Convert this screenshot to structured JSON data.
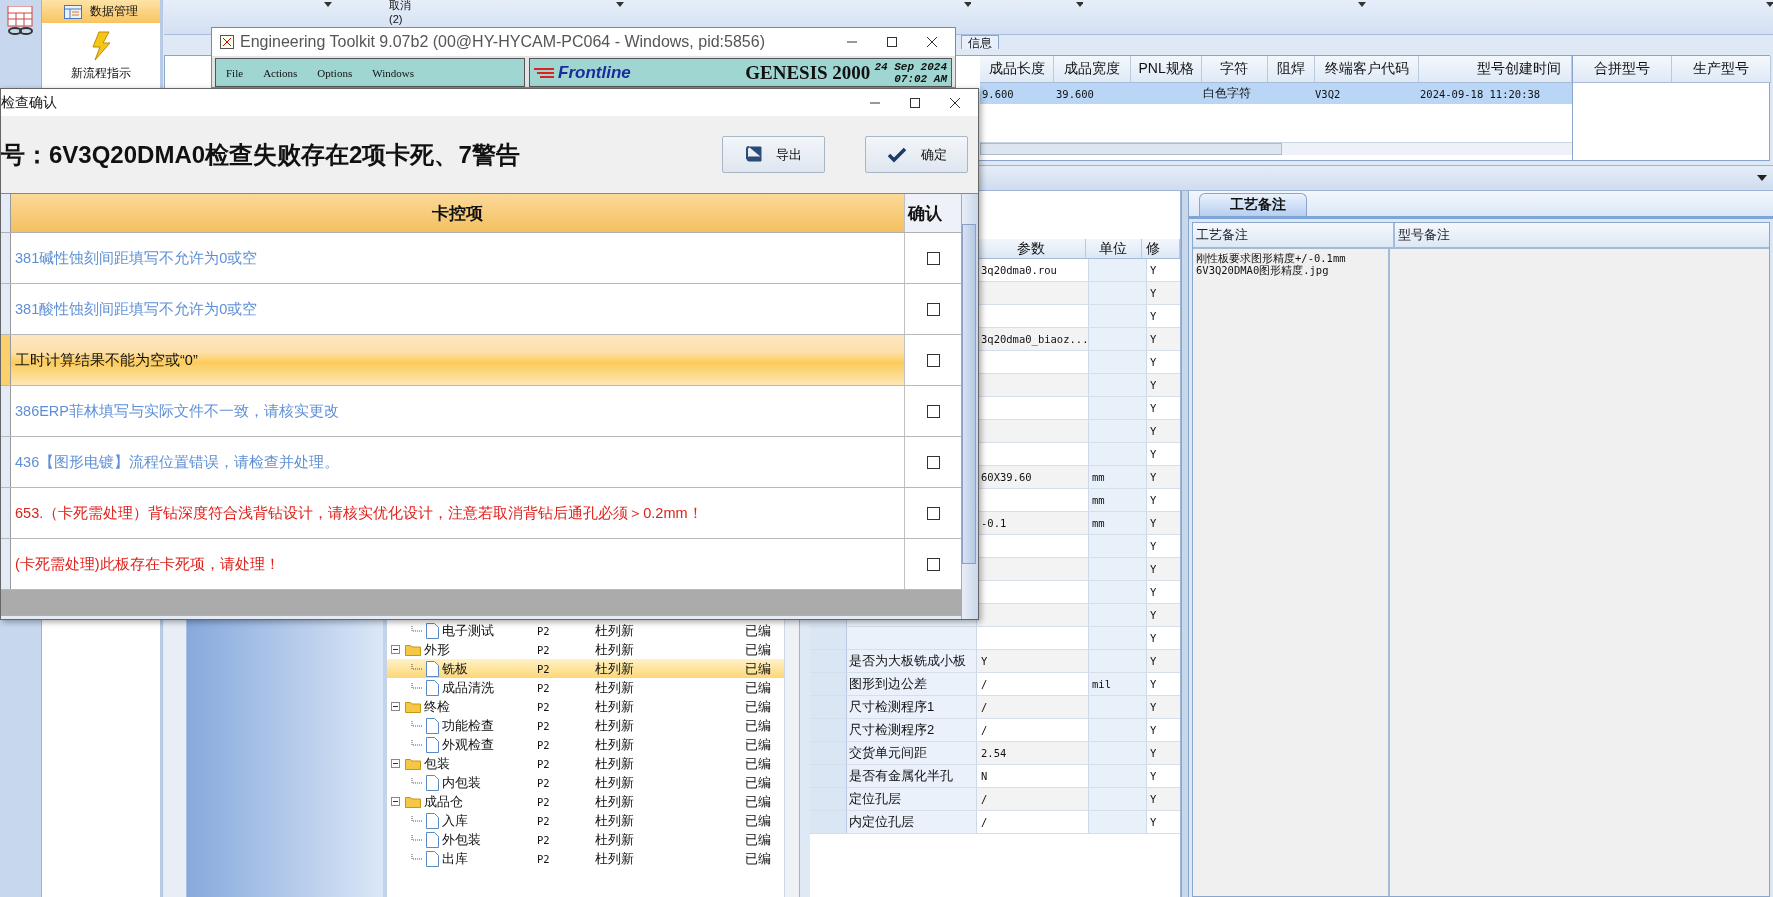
{
  "ribbon": {
    "label": "取消(2)"
  },
  "sidebar": {
    "items": [
      {
        "label": "数据管理",
        "kind": "table",
        "selected": true
      },
      {
        "label": "新流程指示",
        "kind": "flash",
        "selected": false
      }
    ]
  },
  "info_panel": {
    "tab": "信息",
    "columns": [
      "成品长度",
      "成品宽度",
      "PNL规格",
      "字符",
      "阻焊",
      "终端客户代码",
      "型号创建时间"
    ],
    "rows": [
      {
        "cells": [
          "9.600",
          "39.600",
          "",
          "白色字符",
          "",
          "V3Q2",
          "2024-09-18 11:20:38"
        ],
        "selected": true
      }
    ],
    "side_columns": [
      "合拼型号",
      "生产型号"
    ]
  },
  "tree": {
    "nodes": [
      {
        "children": [
          {
            "name": "电子测试",
            "kind": "file",
            "selected": false,
            "cells": [
              "P2",
              "杜列新",
              "已编"
            ]
          }
        ]
      },
      {
        "name": "外形",
        "kind": "folder",
        "expanded": true,
        "selected": false,
        "cells": [
          "P2",
          "杜列新",
          "已编"
        ],
        "children": [
          {
            "name": "铣板",
            "kind": "file",
            "selected": true,
            "cells": [
              "P2",
              "杜列新",
              "已编"
            ]
          },
          {
            "name": "成品清洗",
            "kind": "file",
            "selected": false,
            "cells": [
              "P2",
              "杜列新",
              "已编"
            ]
          }
        ]
      },
      {
        "name": "终检",
        "kind": "folder",
        "expanded": true,
        "selected": false,
        "cells": [
          "P2",
          "杜列新",
          "已编"
        ],
        "children": [
          {
            "name": "功能检查",
            "kind": "file",
            "selected": false,
            "cells": [
              "P2",
              "杜列新",
              "已编"
            ]
          },
          {
            "name": "外观检查",
            "kind": "file",
            "selected": false,
            "cells": [
              "P2",
              "杜列新",
              "已编"
            ]
          }
        ]
      },
      {
        "name": "包装",
        "kind": "folder",
        "expanded": true,
        "selected": false,
        "cells": [
          "P2",
          "杜列新",
          "已编"
        ],
        "children": [
          {
            "name": "内包装",
            "kind": "file",
            "selected": false,
            "cells": [
              "P2",
              "杜列新",
              "已编"
            ]
          }
        ]
      },
      {
        "name": "成品仓",
        "kind": "folder",
        "expanded": true,
        "selected": false,
        "cells": [
          "P2",
          "杜列新",
          "已编"
        ],
        "children": [
          {
            "name": "入库",
            "kind": "file",
            "selected": false,
            "cells": [
              "P2",
              "杜列新",
              "已编"
            ]
          },
          {
            "name": "外包装",
            "kind": "file",
            "selected": false,
            "cells": [
              "P2",
              "杜列新",
              "已编"
            ]
          },
          {
            "name": "出库",
            "kind": "file",
            "selected": false,
            "cells": [
              "P2",
              "杜列新",
              "已编"
            ]
          }
        ]
      }
    ]
  },
  "params": {
    "columns": [
      "参数",
      "单位",
      "修"
    ],
    "rows": [
      {
        "value": "3q20dma0.rou",
        "modified": "Y"
      },
      {
        "modified": "Y"
      },
      {
        "modified": "Y"
      },
      {
        "value": "3q20dma0_biaoz...",
        "modified": "Y"
      },
      {
        "modified": "Y"
      },
      {
        "modified": "Y"
      },
      {
        "modified": "Y"
      },
      {
        "modified": "Y"
      },
      {
        "modified": "Y"
      },
      {
        "value": "60X39.60",
        "unit": "mm",
        "modified": "Y"
      },
      {
        "unit": "mm",
        "modified": "Y"
      },
      {
        "value": "-0.1",
        "unit": "mm",
        "modified": "Y"
      },
      {
        "modified": "Y"
      },
      {
        "modified": "Y"
      },
      {
        "modified": "Y"
      },
      {
        "modified": "Y"
      },
      {
        "modified": "Y"
      },
      {
        "label": "是否为大板铣成小板",
        "value": "Y",
        "modified": "Y"
      },
      {
        "label": "图形到边公差",
        "value": "/",
        "unit": "mil",
        "modified": "Y"
      },
      {
        "label": "尺寸检测程序1",
        "value": "/",
        "modified": "Y"
      },
      {
        "label": "尺寸检测程序2",
        "value": "/",
        "modified": "Y"
      },
      {
        "label": "交货单元间距",
        "value": "2.54",
        "modified": "Y"
      },
      {
        "label": "是否有金属化半孔",
        "value": "N",
        "modified": "Y"
      },
      {
        "label": "定位孔层",
        "value": "/",
        "modified": "Y"
      },
      {
        "label": "内定位孔层",
        "value": "/",
        "modified": "Y"
      }
    ]
  },
  "remarks": {
    "tabs": [
      {
        "label": "工艺备注",
        "selected": true
      }
    ],
    "columns": [
      "工艺备注",
      "型号备注"
    ],
    "process_note": [
      "刚性板要求图形精度+/-0.1mm",
      "6V3Q20DMA0图形精度.jpg"
    ]
  },
  "genesis": {
    "title": "Engineering Toolkit 9.07b2 (00@HY-HYCAM-PC064 - Windows, pid:5856)",
    "menu": [
      "File",
      "Actions",
      "Options",
      "Windows"
    ],
    "logo": "Frontline",
    "product": "GENESIS 2000",
    "date": "24 Sep 2024",
    "time": "07:02 AM"
  },
  "dialog": {
    "title": "检查确认",
    "heading": "号：6V3Q20DMA0检查失败存在2项卡死、7警告",
    "buttons": [
      {
        "label": "导出",
        "kind": "export"
      },
      {
        "label": "确定",
        "kind": "confirm"
      }
    ],
    "columns": [
      "卡控项",
      "确认"
    ],
    "rows": [
      {
        "text": "381碱性蚀刻间距填写不允许为0或空",
        "kind": "warning",
        "selected": false,
        "checked": false
      },
      {
        "text": "381酸性蚀刻间距填写不允许为0或空",
        "kind": "warning",
        "selected": false,
        "checked": false
      },
      {
        "text": "工时计算结果不能为空或“0”",
        "kind": "warning",
        "selected": true,
        "checked": false
      },
      {
        "text": "386ERP菲林填写与实际文件不一致，请核实更改",
        "kind": "warning",
        "selected": false,
        "checked": false
      },
      {
        "text": "436【图形电镀】流程位置错误，请检查并处理。",
        "kind": "warning",
        "selected": false,
        "checked": false
      },
      {
        "text": "653.（卡死需处理）背钻深度符合浅背钻设计，请核实优化设计，注意若取消背钻后通孔必须＞0.2mm！",
        "kind": "blocking",
        "selected": false,
        "checked": false
      },
      {
        "text": "(卡死需处理)此板存在卡死项，请处理！",
        "kind": "blocking",
        "selected": false,
        "checked": false
      }
    ]
  }
}
